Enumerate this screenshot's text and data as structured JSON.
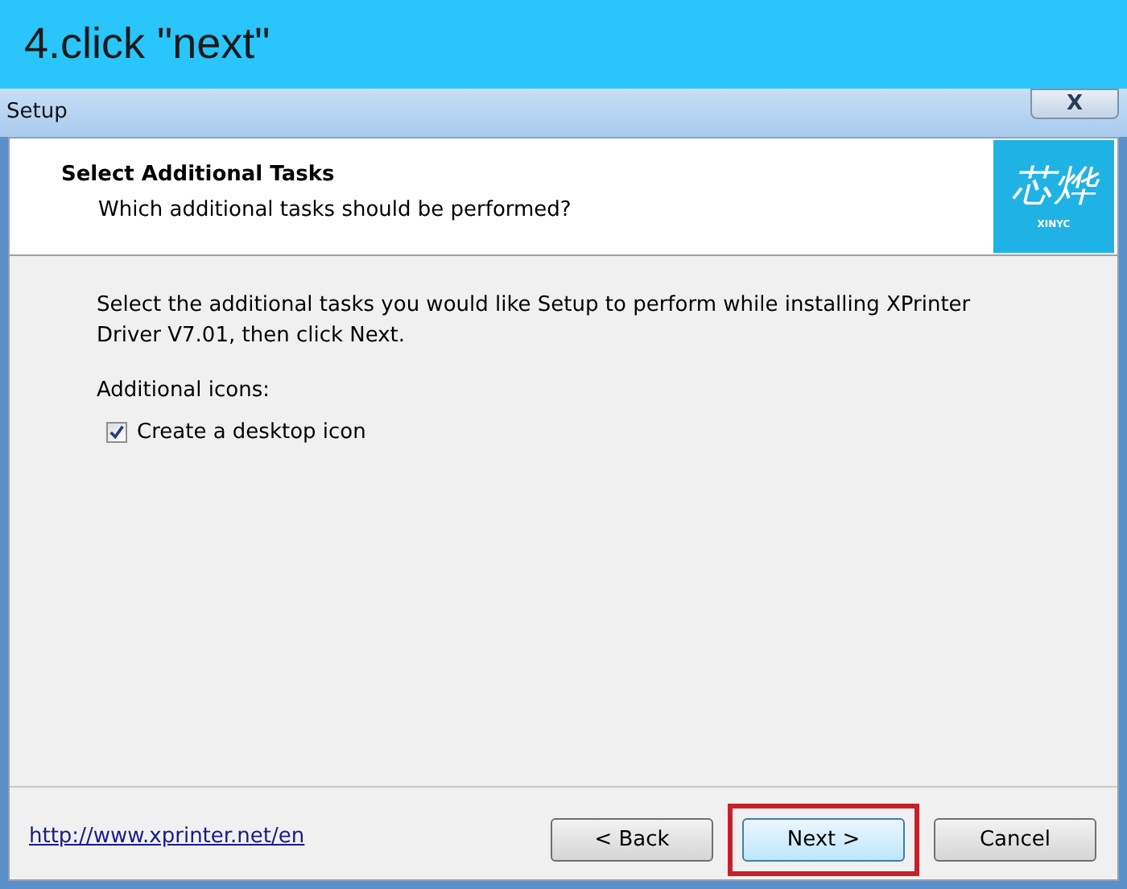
{
  "banner": {
    "text": "4.click \"next\""
  },
  "window": {
    "title": "Setup",
    "close": "X"
  },
  "header": {
    "title": "Select Additional Tasks",
    "subtitle": "Which additional tasks should be performed?",
    "logo": {
      "mark": "芯烨",
      "caption": "XINYC"
    }
  },
  "body": {
    "intro": "Select the additional tasks you would like Setup to perform while installing XPrinter Driver V7.01, then click Next.",
    "group_label": "Additional icons:",
    "tasks": [
      {
        "label": "Create a desktop icon",
        "checked": true
      }
    ]
  },
  "footer": {
    "link": "http://www.xprinter.net/en",
    "buttons": [
      {
        "label": "< Back",
        "focused": false,
        "highlighted": false
      },
      {
        "label": "Next >",
        "focused": true,
        "highlighted": true
      },
      {
        "label": "Cancel",
        "focused": false,
        "highlighted": false
      }
    ]
  }
}
